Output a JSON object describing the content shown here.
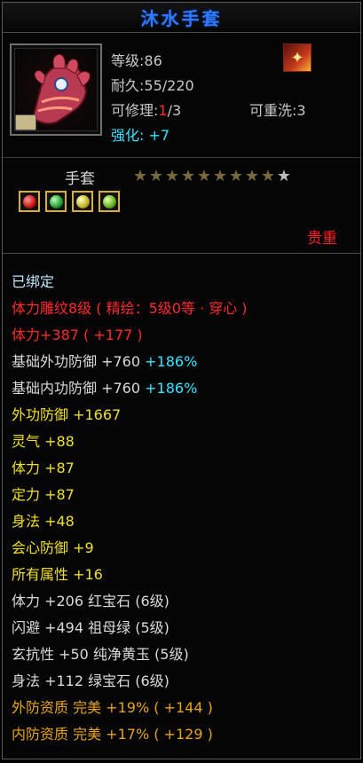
{
  "tooltip": {
    "title": "沐水手套",
    "stats": {
      "level": "等级:86",
      "durability": "耐久:55/220",
      "repair_prefix": "可修理:",
      "repair_current": "1",
      "repair_suffix": "/3",
      "rewash": "可重洗:3",
      "enhance": "强化: +7"
    },
    "item_type": "手套",
    "stars": {
      "filled": 9,
      "total": 10
    },
    "gems": [
      "red",
      "green",
      "yellow",
      "lime"
    ],
    "quality": "贵重",
    "attributes": [
      {
        "text": "已绑定",
        "color": "bound"
      },
      {
        "text": "体力雕纹8级 ( 精绘：5级0等 · 穿心 )",
        "color": "red"
      },
      {
        "text": "体力+387 ( +177 )",
        "color": "red"
      },
      {
        "text": "基础外功防御 +760",
        "extra": " +186%",
        "color": "white"
      },
      {
        "text": "基础内功防御 +760",
        "extra": " +186%",
        "color": "white"
      },
      {
        "text": "外功防御 +1667",
        "color": "yellow"
      },
      {
        "text": "灵气 +88",
        "color": "yellow"
      },
      {
        "text": "体力 +87",
        "color": "yellow"
      },
      {
        "text": "定力 +87",
        "color": "yellow"
      },
      {
        "text": "身法 +48",
        "color": "yellow"
      },
      {
        "text": "会心防御 +9",
        "color": "yellow"
      },
      {
        "text": "所有属性 +16",
        "color": "yellow"
      },
      {
        "text": "体力 +206 红宝石 (6级)",
        "color": "white"
      },
      {
        "text": "闪避 +494 祖母绿 (5级)",
        "color": "white"
      },
      {
        "text": "玄抗性 +50 纯净黄玉 (5级)",
        "color": "white"
      },
      {
        "text": "身法 +112 绿宝石 (6级)",
        "color": "white"
      },
      {
        "text": "外防资质   完美 +19% ( +144 )",
        "color": "orange"
      },
      {
        "text": "内防资质   完美 +17% ( +129 )",
        "color": "orange"
      }
    ]
  },
  "colors": {
    "title": "#2e7bff",
    "red": "#ff2a2a",
    "cyan": "#35e5ff",
    "yellow": "#f0e020",
    "orange": "#e6a418",
    "white": "#dadada"
  },
  "icons": {
    "item": "gauntlet-icon",
    "corner": "fire-emblem-icon",
    "lock": "lock-icon"
  }
}
